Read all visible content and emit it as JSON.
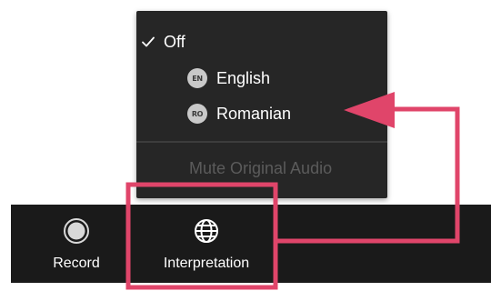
{
  "menu": {
    "items": [
      {
        "label": "Off",
        "checked": true
      },
      {
        "label": "English",
        "badge": "EN"
      },
      {
        "label": "Romanian",
        "badge": "RO"
      }
    ],
    "mute_label": "Mute Original Audio"
  },
  "toolbar": {
    "record_label": "Record",
    "interpretation_label": "Interpretation"
  },
  "colors": {
    "menu_bg": "#262626",
    "toolbar_bg": "#1a1a1a",
    "annotation": "#e0456a",
    "disabled_text": "#5b5b5b"
  },
  "icons": {
    "check": "check-icon",
    "record": "record-icon",
    "interpretation": "globe-icon"
  }
}
